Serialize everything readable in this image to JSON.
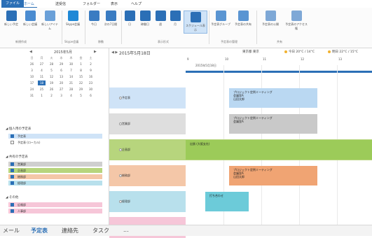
{
  "tabs": [
    "ファイル",
    "ホーム",
    "送受信",
    "フォルダー",
    "表示",
    "ヘルプ"
  ],
  "ribbon_buttons": [
    {
      "label": "新しい予定",
      "color": "#2b6fb6"
    },
    {
      "label": "新しい会議",
      "color": "#2b6fb6"
    },
    {
      "label": "新しいアイテム",
      "color": "#2b6fb6"
    },
    {
      "label": "Skype会議",
      "color": "#2b6fb6"
    },
    {
      "label": "今日",
      "color": "#2b6fb6"
    },
    {
      "label": "次の7日間",
      "color": "#2b6fb6"
    },
    {
      "label": "日",
      "color": "#2b6fb6"
    },
    {
      "label": "稼働日",
      "color": "#2b6fb6"
    },
    {
      "label": "週",
      "color": "#2b6fb6"
    },
    {
      "label": "月",
      "color": "#2b6fb6"
    },
    {
      "label": "スケジュール表示",
      "color": "#2b6fb6"
    },
    {
      "label": "予定表グループ",
      "color": "#2b6fb6"
    },
    {
      "label": "予定表の共有",
      "color": "#2b6fb6"
    },
    {
      "label": "予定表の公開",
      "color": "#2b6fb6"
    },
    {
      "label": "予定表のアクセス権",
      "color": "#2b6fb6"
    }
  ],
  "ribbon_groups": [
    "新規作成",
    "Skype会議",
    "移動",
    "表示形式",
    "予定表の管理",
    "共有"
  ],
  "minical": {
    "title": "2015年5月",
    "weekdays": [
      "日",
      "月",
      "火",
      "水",
      "木",
      "金",
      "土"
    ],
    "days": [
      [
        "26",
        "27",
        "28",
        "29",
        "30",
        "1",
        "2"
      ],
      [
        "3",
        "4",
        "5",
        "6",
        "7",
        "8",
        "9"
      ],
      [
        "10",
        "11",
        "12",
        "13",
        "14",
        "15",
        "16"
      ],
      [
        "17",
        "18",
        "19",
        "20",
        "21",
        "22",
        "23"
      ],
      [
        "24",
        "25",
        "26",
        "27",
        "28",
        "29",
        "30"
      ],
      [
        "31",
        "1",
        "2",
        "3",
        "4",
        "5",
        "6"
      ]
    ]
  },
  "calendar_groups": [
    {
      "title": "個人用の予定表",
      "items": [
        {
          "label": "予定表",
          "color": "#cfe3f7",
          "checked": true
        },
        {
          "label": "予定表 (ローカル)",
          "color": "#ffffff",
          "checked": false
        }
      ]
    },
    {
      "title": "共有の予定表",
      "items": [
        {
          "label": "営業部",
          "color": "#cfcfcf",
          "checked": true
        },
        {
          "label": "企画部",
          "color": "#b7d57d",
          "checked": true
        },
        {
          "label": "総務部",
          "color": "#f4c7a8",
          "checked": true
        },
        {
          "label": "経理部",
          "color": "#b8e0ec",
          "checked": true
        }
      ]
    },
    {
      "title": "その他",
      "items": [
        {
          "label": "広報部",
          "color": "#f6c6d8",
          "checked": true
        },
        {
          "label": "人事部",
          "color": "#f6c6d8",
          "checked": true
        }
      ]
    }
  ],
  "status_nav": [
    "メール",
    "予定表",
    "連絡先",
    "タスク",
    "..."
  ],
  "main": {
    "date_title": "2015年5月18日",
    "right_labels": [
      "東京都 東京",
      "今日 20°C / 14°C",
      "明日 22°C / 15°C"
    ],
    "hours": [
      "9",
      "10",
      "11",
      "12",
      "13"
    ],
    "subhdr": "2015年5月18日"
  },
  "rows": [
    {
      "label": "予定表",
      "color": "#cfe3f7",
      "appt": {
        "text": "プロジェクト定例ミーティング\n会議室A\n山田太郎",
        "color": "#bad8f2"
      }
    },
    {
      "label": "営業部",
      "color": "#dedede",
      "appt": {
        "text": "プロジェクト定例ミーティング\n会議室A",
        "color": "#c9c9c9"
      }
    },
    {
      "label": "企画部",
      "color": "#b7d57d",
      "appt": {
        "text": "出張 (大阪支社)",
        "color": "#9ccb59"
      }
    },
    {
      "label": "総務部",
      "color": "#f4c7a8",
      "appt": {
        "text": "プロジェクト定例ミーティング\n会議室A\n山田太郎",
        "color": "#f0a473"
      }
    },
    {
      "label": "経理部",
      "color": "#b8e0ec",
      "appt": {
        "text": "打ち合わせ",
        "color": "#6ccbd9"
      }
    },
    {
      "label": "広報部",
      "color": "#f6c6d8",
      "appt": null
    }
  ]
}
